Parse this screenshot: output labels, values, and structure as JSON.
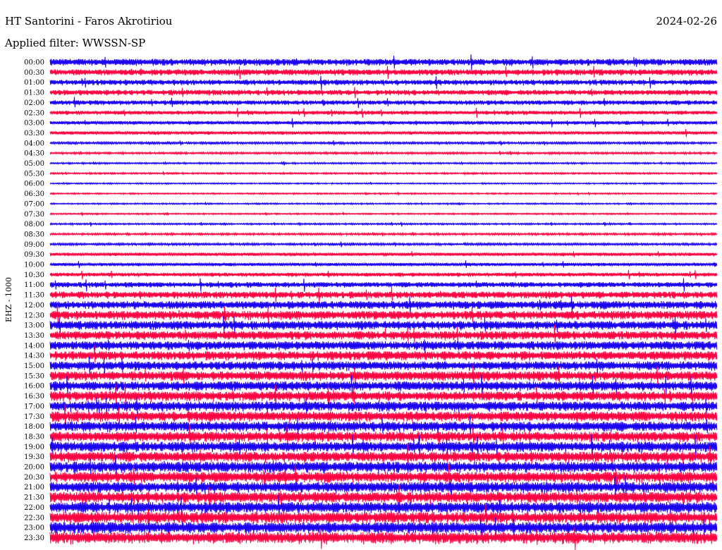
{
  "header": {
    "title": "HT Santorini - Faros Akrotiriou",
    "date": "2024-02-26",
    "filter": "Applied filter: WWSSN-SP"
  },
  "chart_data": {
    "type": "line",
    "ylabel": "EHZ - 1000",
    "row_labels": [
      "00:00",
      "00:30",
      "01:00",
      "01:30",
      "02:00",
      "02:30",
      "03:00",
      "03:30",
      "04:00",
      "04:30",
      "05:00",
      "05:30",
      "06:00",
      "06:30",
      "07:00",
      "07:30",
      "08:00",
      "08:30",
      "09:00",
      "09:30",
      "10:00",
      "10:30",
      "11:00",
      "11:30",
      "12:00",
      "12:30",
      "13:00",
      "13:30",
      "14:00",
      "14:30",
      "15:00",
      "15:30",
      "16:00",
      "16:30",
      "17:00",
      "17:30",
      "18:00",
      "18:30",
      "19:00",
      "19:30",
      "20:00",
      "20:30",
      "21:00",
      "21:30",
      "22:00",
      "22:30",
      "23:00",
      "23:30"
    ],
    "colors": [
      "#1a00f0",
      "#ff0040"
    ],
    "noise_level": [
      1.0,
      0.9,
      0.8,
      0.8,
      0.7,
      0.6,
      0.55,
      0.5,
      0.35,
      0.3,
      0.25,
      0.25,
      0.2,
      0.22,
      0.22,
      0.22,
      0.25,
      0.3,
      0.35,
      0.5,
      0.5,
      0.6,
      0.8,
      1.0,
      1.2,
      1.3,
      1.3,
      1.3,
      1.3,
      1.35,
      1.35,
      1.4,
      1.4,
      1.45,
      1.45,
      1.5,
      1.5,
      1.5,
      1.55,
      1.55,
      1.6,
      1.6,
      1.6,
      1.65,
      1.65,
      1.7,
      1.7,
      1.75
    ]
  }
}
